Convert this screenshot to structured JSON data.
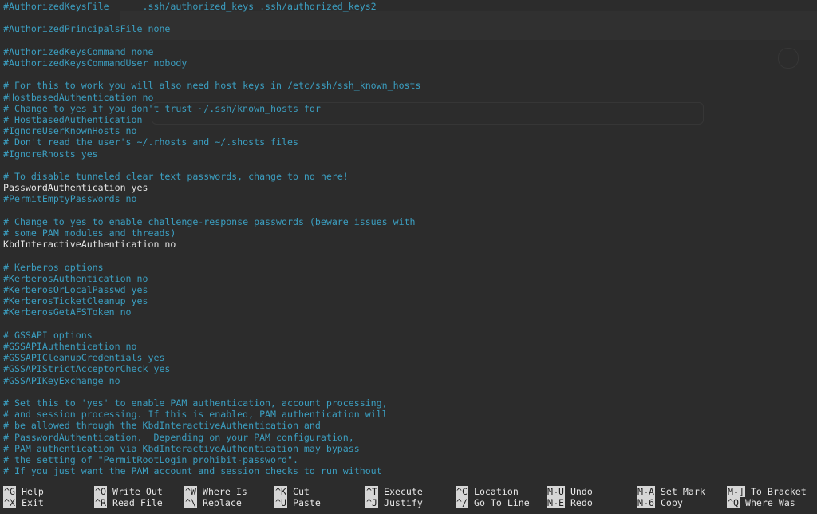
{
  "editor": {
    "lines": [
      {
        "text": "#AuthorizedKeysFile      .ssh/authorized_keys .ssh/authorized_keys2",
        "kind": "comment"
      },
      {
        "text": "",
        "kind": "blank"
      },
      {
        "text": "#AuthorizedPrincipalsFile none",
        "kind": "comment"
      },
      {
        "text": "",
        "kind": "blank"
      },
      {
        "text": "#AuthorizedKeysCommand none",
        "kind": "comment"
      },
      {
        "text": "#AuthorizedKeysCommandUser nobody",
        "kind": "comment"
      },
      {
        "text": "",
        "kind": "blank"
      },
      {
        "text": "# For this to work you will also need host keys in /etc/ssh/ssh_known_hosts",
        "kind": "comment"
      },
      {
        "text": "#HostbasedAuthentication no",
        "kind": "comment"
      },
      {
        "text": "# Change to yes if you don't trust ~/.ssh/known_hosts for",
        "kind": "comment"
      },
      {
        "text": "# HostbasedAuthentication",
        "kind": "comment"
      },
      {
        "text": "#IgnoreUserKnownHosts no",
        "kind": "comment"
      },
      {
        "text": "# Don't read the user's ~/.rhosts and ~/.shosts files",
        "kind": "comment"
      },
      {
        "text": "#IgnoreRhosts yes",
        "kind": "comment"
      },
      {
        "text": "",
        "kind": "blank"
      },
      {
        "text": "# To disable tunneled clear text passwords, change to no here!",
        "kind": "comment"
      },
      {
        "text": "PasswordAuthentication yes",
        "kind": "directive"
      },
      {
        "text": "#PermitEmptyPasswords no",
        "kind": "comment"
      },
      {
        "text": "",
        "kind": "blank"
      },
      {
        "text": "# Change to yes to enable challenge-response passwords (beware issues with",
        "kind": "comment"
      },
      {
        "text": "# some PAM modules and threads)",
        "kind": "comment"
      },
      {
        "text": "KbdInteractiveAuthentication no",
        "kind": "directive"
      },
      {
        "text": "",
        "kind": "blank"
      },
      {
        "text": "# Kerberos options",
        "kind": "comment"
      },
      {
        "text": "#KerberosAuthentication no",
        "kind": "comment"
      },
      {
        "text": "#KerberosOrLocalPasswd yes",
        "kind": "comment"
      },
      {
        "text": "#KerberosTicketCleanup yes",
        "kind": "comment"
      },
      {
        "text": "#KerberosGetAFSToken no",
        "kind": "comment"
      },
      {
        "text": "",
        "kind": "blank"
      },
      {
        "text": "# GSSAPI options",
        "kind": "comment"
      },
      {
        "text": "#GSSAPIAuthentication no",
        "kind": "comment"
      },
      {
        "text": "#GSSAPICleanupCredentials yes",
        "kind": "comment"
      },
      {
        "text": "#GSSAPIStrictAcceptorCheck yes",
        "kind": "comment"
      },
      {
        "text": "#GSSAPIKeyExchange no",
        "kind": "comment"
      },
      {
        "text": "",
        "kind": "blank"
      },
      {
        "text": "# Set this to 'yes' to enable PAM authentication, account processing,",
        "kind": "comment"
      },
      {
        "text": "# and session processing. If this is enabled, PAM authentication will",
        "kind": "comment"
      },
      {
        "text": "# be allowed through the KbdInteractiveAuthentication and",
        "kind": "comment"
      },
      {
        "text": "# PasswordAuthentication.  Depending on your PAM configuration,",
        "kind": "comment"
      },
      {
        "text": "# PAM authentication via KbdInteractiveAuthentication may bypass",
        "kind": "comment"
      },
      {
        "text": "# the setting of \"PermitRootLogin prohibit-password\".",
        "kind": "comment"
      },
      {
        "text": "# If you just want the PAM account and session checks to run without",
        "kind": "comment"
      }
    ]
  },
  "shortcuts": [
    [
      {
        "key": "^G",
        "label": "Help"
      },
      {
        "key": "^O",
        "label": "Write Out"
      },
      {
        "key": "^W",
        "label": "Where Is"
      },
      {
        "key": "^K",
        "label": "Cut"
      },
      {
        "key": "^T",
        "label": "Execute"
      },
      {
        "key": "^C",
        "label": "Location"
      },
      {
        "key": "M-U",
        "label": "Undo"
      },
      {
        "key": "M-A",
        "label": "Set Mark"
      },
      {
        "key": "M-]",
        "label": "To Bracket"
      }
    ],
    [
      {
        "key": "^X",
        "label": "Exit"
      },
      {
        "key": "^R",
        "label": "Read File"
      },
      {
        "key": "^\\",
        "label": "Replace"
      },
      {
        "key": "^U",
        "label": "Paste"
      },
      {
        "key": "^J",
        "label": "Justify"
      },
      {
        "key": "^/",
        "label": "Go To Line"
      },
      {
        "key": "M-E",
        "label": "Redo"
      },
      {
        "key": "M-6",
        "label": "Copy"
      },
      {
        "key": "^Q",
        "label": "Where Was"
      }
    ]
  ],
  "colors": {
    "background": "#2c2c2c",
    "comment": "#3b9ec0",
    "directive": "#e6e6e6",
    "key_background": "#d6d6d6"
  }
}
